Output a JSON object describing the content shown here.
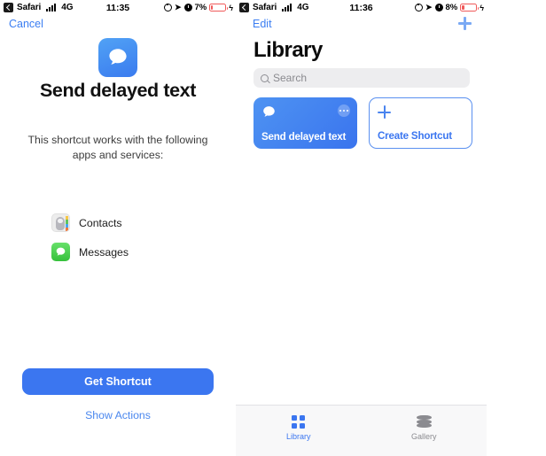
{
  "left": {
    "status_bar": {
      "back_app": "Safari",
      "network": "4G",
      "time": "11:35",
      "battery_percent": "7%",
      "icons": [
        "back-chevron-icon",
        "signal-bars-icon",
        "location-arrow-icon",
        "alarm-icon",
        "rotation-lock-icon",
        "battery-icon",
        "charging-bolt-icon"
      ]
    },
    "cancel_label": "Cancel",
    "hero_icon": "messages-bubble-icon",
    "title": "Send delayed text",
    "subtitle": "This shortcut works with the following apps and services:",
    "apps": [
      {
        "name": "Contacts",
        "icon": "contacts-app-icon"
      },
      {
        "name": "Messages",
        "icon": "messages-app-icon"
      }
    ],
    "primary_button": "Get Shortcut",
    "secondary_link": "Show Actions"
  },
  "right": {
    "status_bar": {
      "back_app": "Safari",
      "network": "4G",
      "time": "11:36",
      "battery_percent": "8%",
      "icons": [
        "back-chevron-icon",
        "signal-bars-icon",
        "location-arrow-icon",
        "alarm-icon",
        "rotation-lock-icon",
        "battery-icon",
        "charging-bolt-icon"
      ]
    },
    "edit_label": "Edit",
    "add_icon": "plus-icon",
    "title": "Library",
    "search": {
      "placeholder": "Search",
      "value": "",
      "icon": "search-icon"
    },
    "cards": [
      {
        "label": "Send delayed text",
        "icon": "messages-bubble-icon",
        "more_icon": "ellipsis-icon",
        "type": "shortcut"
      },
      {
        "label": "Create Shortcut",
        "icon": "plus-icon",
        "type": "create"
      }
    ],
    "tabs": [
      {
        "label": "Library",
        "icon": "grid-icon",
        "active": true
      },
      {
        "label": "Gallery",
        "icon": "stack-icon",
        "active": false
      }
    ]
  },
  "colors": {
    "accent": "#3b76f0",
    "link": "#3b7ef2",
    "card_blue": "#4583f1",
    "battery_red": "#f05a5a",
    "tabbar_bg": "#f8f8f9",
    "search_bg": "#ededef"
  }
}
